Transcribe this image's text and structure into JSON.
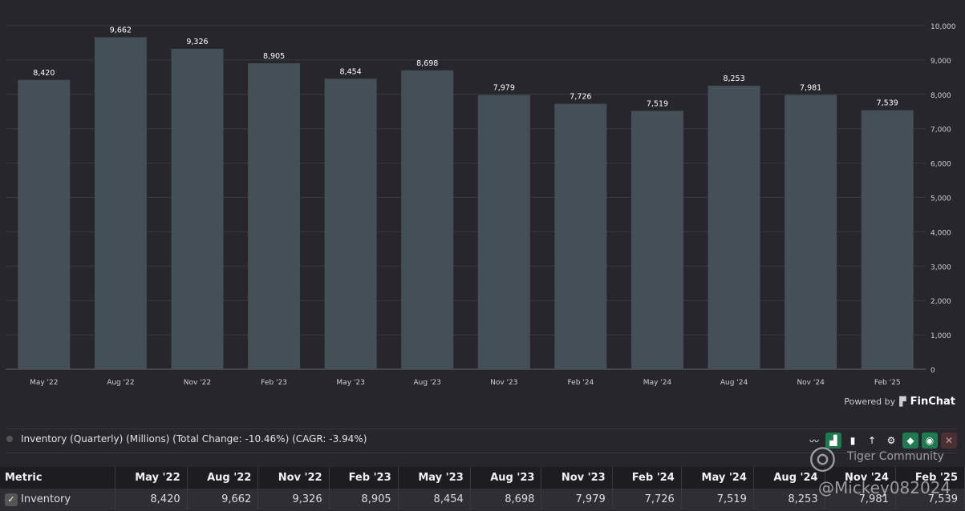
{
  "chart_data": {
    "type": "bar",
    "categories": [
      "May '22",
      "Aug '22",
      "Nov '22",
      "Feb '23",
      "May '23",
      "Aug '23",
      "Nov '23",
      "Feb '24",
      "May '24",
      "Aug '24",
      "Nov '24",
      "Feb '25"
    ],
    "values": [
      8420,
      9662,
      9326,
      8905,
      8454,
      8698,
      7979,
      7726,
      7519,
      8253,
      7981,
      7539
    ],
    "value_labels": [
      "8,420",
      "9,662",
      "9,326",
      "8,905",
      "8,454",
      "8,698",
      "7,979",
      "7,726",
      "7,519",
      "8,253",
      "7,981",
      "7,539"
    ],
    "ylim": [
      0,
      10000
    ],
    "yticks": [
      "0",
      "1,000",
      "2,000",
      "3,000",
      "4,000",
      "5,000",
      "6,000",
      "7,000",
      "8,000",
      "9,000",
      "10,000"
    ],
    "grid": true,
    "bar_color": "#454f57"
  },
  "powered_by": "Powered by",
  "brand": "FinChat",
  "legend": "Inventory (Quarterly) (Millions) (Total Change: -10.46%) (CAGR: -3.94%)",
  "table": {
    "header": "Metric",
    "columns": [
      "May '22",
      "Aug '22",
      "Nov '22",
      "Feb '23",
      "May '23",
      "Aug '23",
      "Nov '23",
      "Feb '24",
      "May '24",
      "Aug '24",
      "Nov '24",
      "Feb '25"
    ],
    "rows": [
      {
        "label": "Inventory",
        "values": [
          "8,420",
          "9,662",
          "9,326",
          "8,905",
          "8,454",
          "8,698",
          "7,979",
          "7,726",
          "7,519",
          "8,253",
          "7,981",
          "7,539"
        ]
      }
    ]
  },
  "watermark": {
    "community": "Tiger Community",
    "user": "@Mickey082024"
  }
}
